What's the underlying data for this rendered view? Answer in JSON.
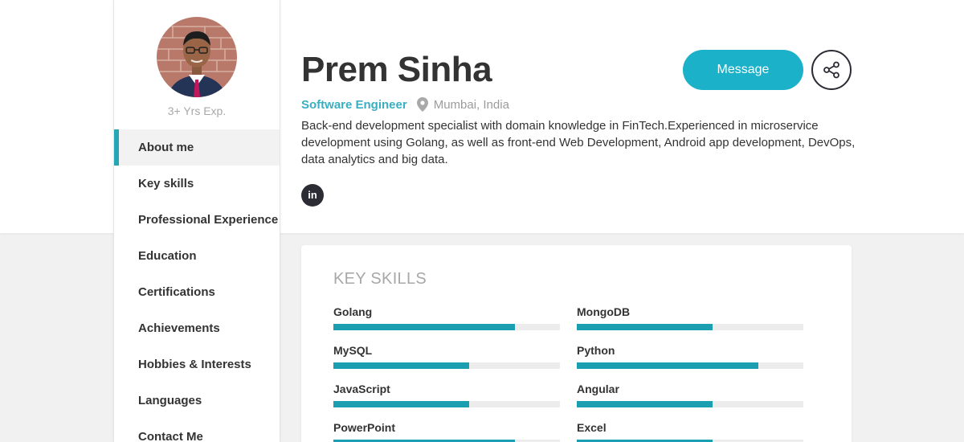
{
  "profile": {
    "name": "Prem Sinha",
    "role": "Software Engineer",
    "location": "Mumbai, India",
    "experience": "3+ Yrs Exp.",
    "bio": "Back-end development specialist with domain knowledge in FinTech.Experienced in microservice development using Golang, as well as front-end Web Development, Android app development, DevOps, data analytics and big data.",
    "social": {
      "linkedin_label": "in"
    },
    "actions": {
      "message_label": "Message"
    }
  },
  "sidebar": {
    "items": [
      {
        "label": "About me",
        "active": true
      },
      {
        "label": "Key skills"
      },
      {
        "label": "Professional Experience"
      },
      {
        "label": "Education"
      },
      {
        "label": "Certifications"
      },
      {
        "label": "Achievements"
      },
      {
        "label": "Hobbies & Interests"
      },
      {
        "label": "Languages"
      },
      {
        "label": "Contact Me"
      }
    ]
  },
  "key_skills": {
    "title": "KEY SKILLS",
    "items": [
      {
        "name": "Golang",
        "level": 0.8
      },
      {
        "name": "MongoDB",
        "level": 0.6
      },
      {
        "name": "MySQL",
        "level": 0.6
      },
      {
        "name": "Python",
        "level": 0.8
      },
      {
        "name": "JavaScript",
        "level": 0.6
      },
      {
        "name": "Angular",
        "level": 0.6
      },
      {
        "name": "PowerPoint",
        "level": 0.8
      },
      {
        "name": "Excel",
        "level": 0.6
      }
    ]
  },
  "colors": {
    "accent": "#1ab1c9",
    "skill_bar": "#1b9fb0",
    "role_text": "#3aaec2",
    "dark": "#2c2c35"
  }
}
